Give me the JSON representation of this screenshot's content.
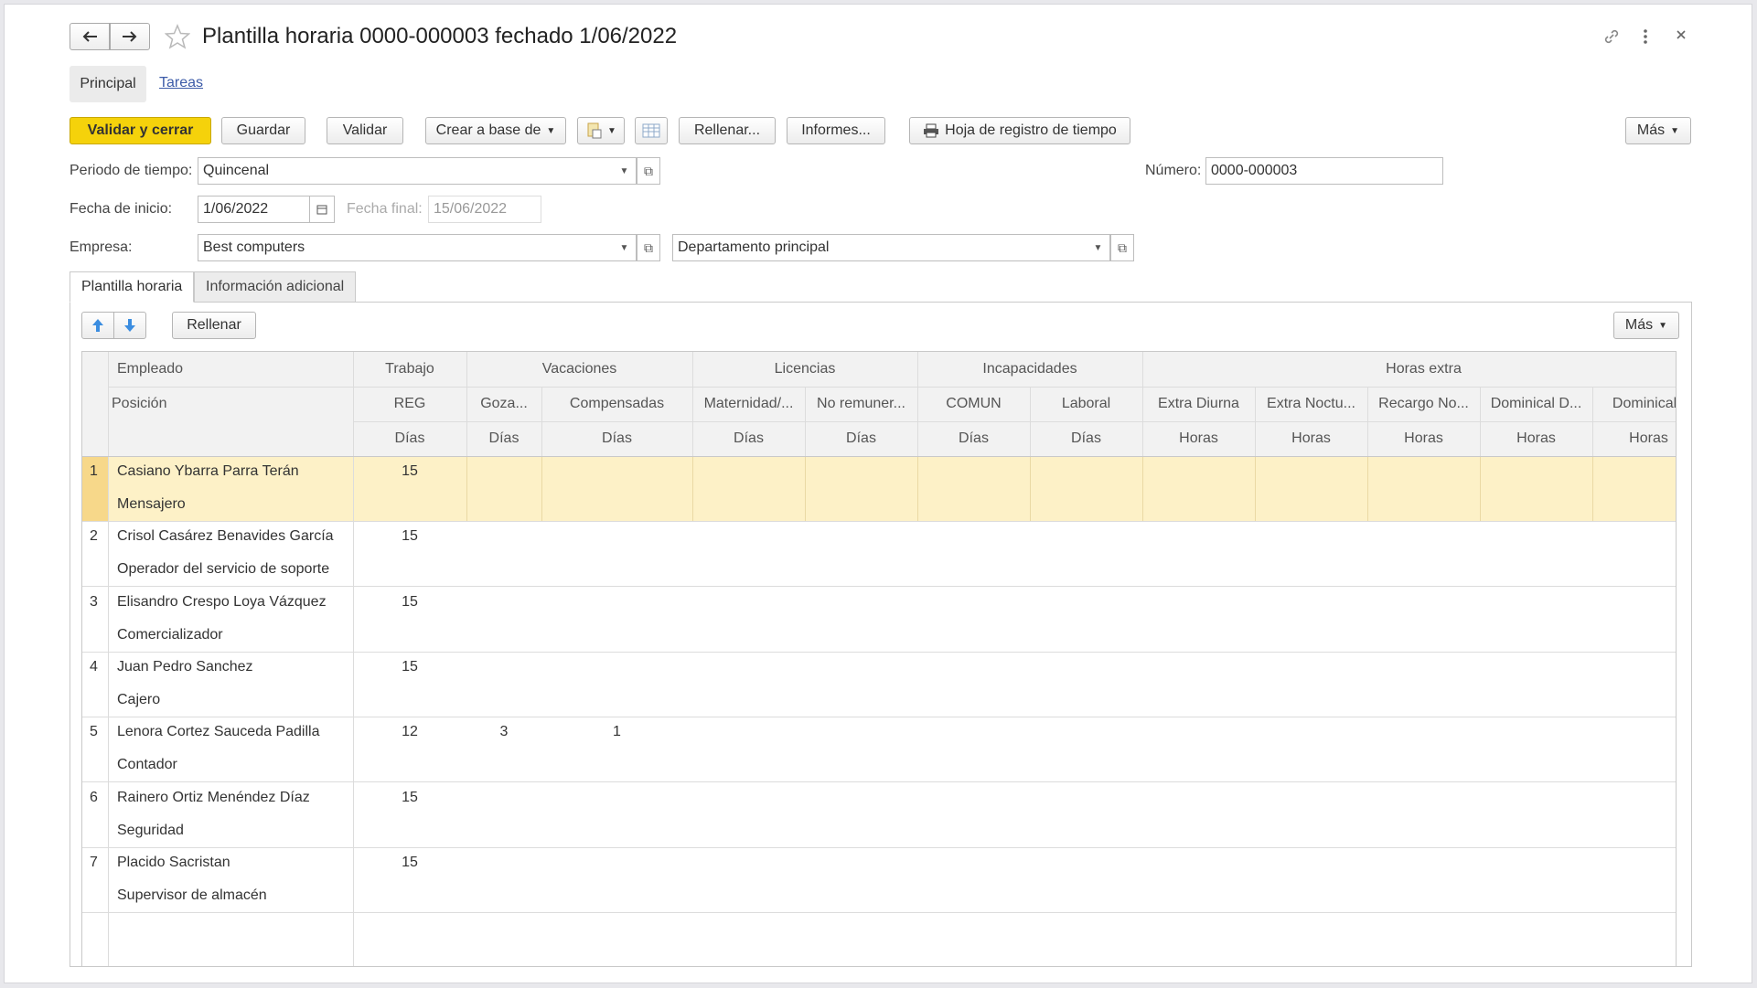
{
  "window": {
    "title": "Plantilla horaria 0000-000003 fechado 1/06/2022"
  },
  "nav_tabs": [
    "Principal",
    "Tareas"
  ],
  "toolbar": {
    "validate_close": "Validar y cerrar",
    "save": "Guardar",
    "validate": "Validar",
    "create_based": "Crear a base de",
    "fill": "Rellenar...",
    "reports": "Informes...",
    "timesheet": "Hoja de registro de tiempo",
    "more": "Más"
  },
  "form": {
    "period_label": "Periodo de tiempo:",
    "period_value": "Quincenal",
    "number_label": "Número:",
    "number_value": "0000-000003",
    "start_label": "Fecha de inicio:",
    "start_value": "1/06/2022",
    "end_label": "Fecha final:",
    "end_value": "15/06/2022",
    "company_label": "Empresa:",
    "company_value": "Best computers",
    "department_value": "Departamento principal"
  },
  "content_tabs": [
    "Plantilla horaria",
    "Información adicional"
  ],
  "table_toolbar": {
    "fill": "Rellenar",
    "more": "Más"
  },
  "table": {
    "group_headers": [
      "Empleado",
      "Trabajo",
      "Vacaciones",
      "Licencias",
      "Incapacidades",
      "Horas extra"
    ],
    "sub_headers": [
      "Posición",
      "REG",
      "Goza...",
      "Compensadas",
      "Maternidad/...",
      "No remuner...",
      "COMUN",
      "Laboral",
      "Extra Diurna",
      "Extra Noctu...",
      "Recargo No...",
      "Dominical D...",
      "Dominical I"
    ],
    "unit_headers": [
      "Días",
      "Días",
      "Días",
      "Días",
      "Días",
      "Días",
      "Días",
      "Horas",
      "Horas",
      "Horas",
      "Horas",
      "Horas"
    ],
    "rows": [
      {
        "n": "1",
        "employee": "Casiano Ybarra Parra Terán",
        "position": "Mensajero",
        "reg": "15",
        "goza": "",
        "comp": ""
      },
      {
        "n": "2",
        "employee": "Crisol Casárez Benavides García",
        "position": "Operador del servicio de soporte",
        "reg": "15",
        "goza": "",
        "comp": ""
      },
      {
        "n": "3",
        "employee": "Elisandro Crespo Loya Vázquez",
        "position": "Comercializador",
        "reg": "15",
        "goza": "",
        "comp": ""
      },
      {
        "n": "4",
        "employee": "Juan Pedro Sanchez",
        "position": "Cajero",
        "reg": "15",
        "goza": "",
        "comp": ""
      },
      {
        "n": "5",
        "employee": "Lenora Cortez Sauceda Padilla",
        "position": "Contador",
        "reg": "12",
        "goza": "3",
        "comp": "1"
      },
      {
        "n": "6",
        "employee": "Rainero Ortiz Menéndez Díaz",
        "position": "Seguridad",
        "reg": "15",
        "goza": "",
        "comp": ""
      },
      {
        "n": "7",
        "employee": "Placido Sacristan",
        "position": "Supervisor de almacén",
        "reg": "15",
        "goza": "",
        "comp": ""
      }
    ]
  },
  "colors": {
    "primary_button": "#f5d20b",
    "selected_row": "#fdf1c7",
    "link": "#3c5ba8"
  }
}
